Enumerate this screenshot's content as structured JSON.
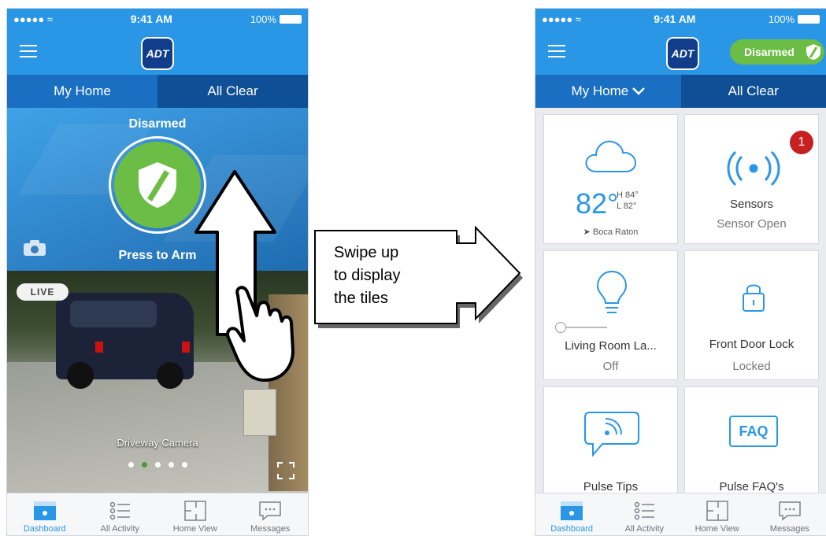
{
  "status": {
    "time": "9:41 AM",
    "battery": "100%",
    "signal": "●●●●● ≈"
  },
  "brand": {
    "logo_text": "ADT"
  },
  "left": {
    "segments": [
      "My Home",
      "All Clear"
    ],
    "hero": {
      "state": "Disarmed",
      "action": "Press to Arm"
    },
    "camera": {
      "live_badge": "LIVE",
      "name": "Driveway Camera",
      "dots": 5,
      "active_dot": 1
    },
    "colors": {
      "primary": "#2a96e6",
      "armed_green": "#6cbd45",
      "nav_dark": "#0f4f96"
    }
  },
  "callout": {
    "line1": "Swipe up",
    "line2": "to display",
    "line3": "the tiles"
  },
  "right": {
    "status_pill": "Disarmed",
    "segments": [
      "My Home",
      "All Clear"
    ],
    "tiles": {
      "weather": {
        "temp": "82°",
        "high": "H 84°",
        "low": "L 82°",
        "location": "Boca Raton"
      },
      "sensors": {
        "title": "Sensors",
        "sub": "Sensor Open",
        "badge": "1"
      },
      "light": {
        "title": "Living Room La...",
        "sub": "Off"
      },
      "lock": {
        "title": "Front Door Lock",
        "sub": "Locked"
      },
      "tips": {
        "title": "Pulse Tips"
      },
      "faq": {
        "title": "Pulse FAQ's",
        "icon_text": "FAQ"
      }
    }
  },
  "tabs": [
    "Dashboard",
    "All Activity",
    "Home View",
    "Messages"
  ]
}
